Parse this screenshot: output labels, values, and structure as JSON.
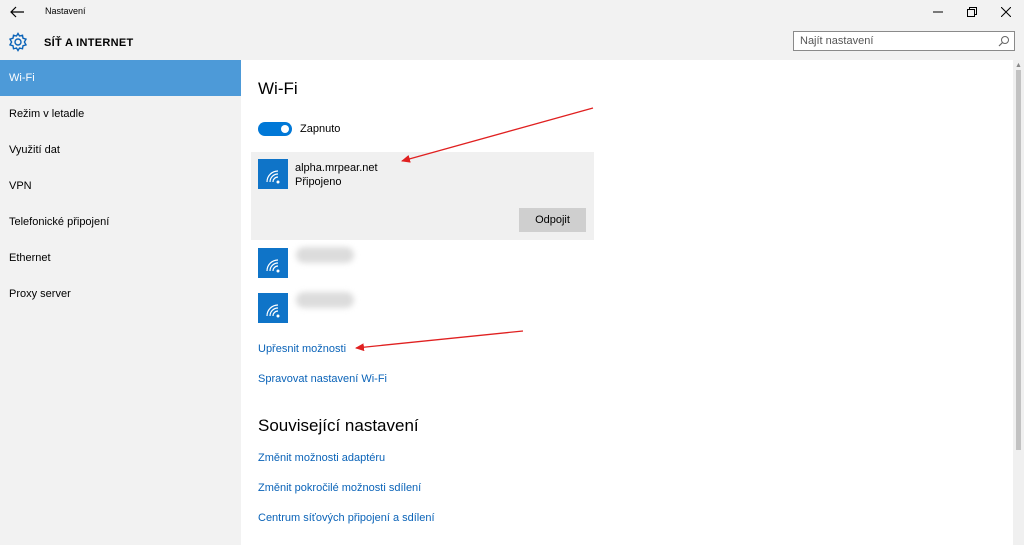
{
  "window": {
    "title": "Nastavení"
  },
  "header": {
    "section": "SÍŤ A INTERNET",
    "search_placeholder": "Najít nastavení"
  },
  "sidebar": {
    "items": [
      {
        "label": "Wi-Fi",
        "active": true
      },
      {
        "label": "Režim v letadle"
      },
      {
        "label": "Využití dat"
      },
      {
        "label": "VPN"
      },
      {
        "label": "Telefonické připojení"
      },
      {
        "label": "Ethernet"
      },
      {
        "label": "Proxy server"
      }
    ]
  },
  "main": {
    "title": "Wi-Fi",
    "toggle_label": "Zapnuto",
    "toggle_on": true,
    "connected_network": {
      "name": "alpha.mrpear.net",
      "status": "Připojeno",
      "disconnect_label": "Odpojit"
    },
    "advanced_link": "Upřesnit možnosti",
    "manage_link": "Spravovat nastavení Wi-Fi",
    "related_title": "Související nastavení",
    "related_links": [
      "Změnit možnosti adaptéru",
      "Změnit pokročilé možnosti sdílení",
      "Centrum síťových připojení a sdílení"
    ]
  },
  "colors": {
    "accent": "#0078d7",
    "sidebar_active": "#4d9ad8",
    "link": "#0a63b8",
    "annotation_arrow": "#e02020"
  },
  "icons": {
    "back": "arrow-left-icon",
    "settings": "gear-icon",
    "search": "search-icon",
    "network": "wifi-icon"
  }
}
